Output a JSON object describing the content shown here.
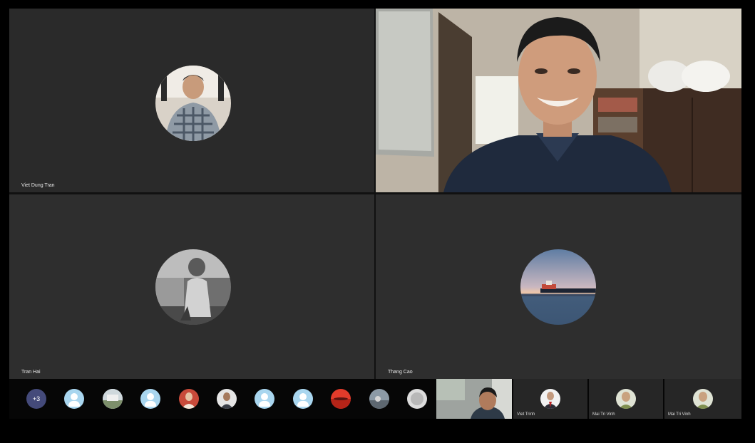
{
  "participants": [
    {
      "name": "Viet Dung Tran"
    },
    {
      "name": ""
    },
    {
      "name": "Tran Hai"
    },
    {
      "name": "Thang Cao"
    }
  ],
  "strip": {
    "overflow_count": "+3",
    "bottom_tiles": [
      {
        "name": "Viet Trinh"
      },
      {
        "name": "Mai Tri Vinh"
      },
      {
        "name": "Mai Tri Vinh"
      }
    ]
  },
  "colors": {
    "tile_bg": "#2a2a2a",
    "strip_bg": "#060606",
    "default_avatar": "#a9d6ef",
    "overflow_badge": "#444a7a"
  },
  "icons": [
    "person-avatar-icon"
  ]
}
